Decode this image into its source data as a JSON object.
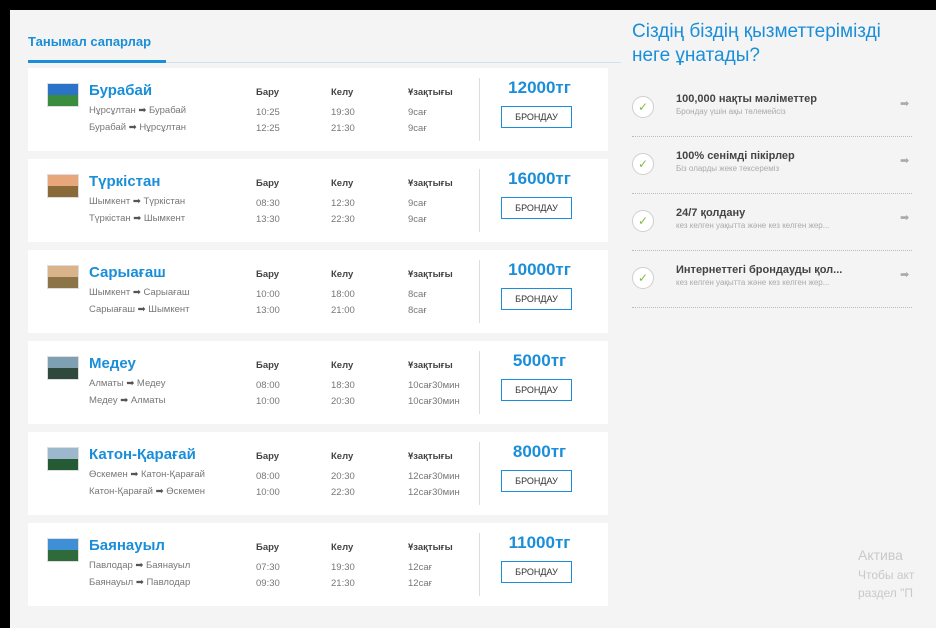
{
  "tab": {
    "label": "Танымал сапарлар"
  },
  "columns": {
    "depart": "Бару",
    "arrive": "Келу",
    "duration": "Ұзақтығы"
  },
  "book_label": "БРОНДАУ",
  "arrow": "➡",
  "trips": [
    {
      "city": "Бурабай",
      "route1_from": "Нұрсұлтан",
      "route1_to": "Бурабай",
      "route2_from": "Бурабай",
      "route2_to": "Нұрсұлтан",
      "dep1": "10:25",
      "arr1": "19:30",
      "dur1": "9сағ",
      "dep2": "12:25",
      "arr2": "21:30",
      "dur2": "9сағ",
      "price": "12000тг",
      "thumb_sky": "#2a73c9",
      "thumb_ground": "#3a8d3f"
    },
    {
      "city": "Түркістан",
      "route1_from": "Шымкент",
      "route1_to": "Түркістан",
      "route2_from": "Түркістан",
      "route2_to": "Шымкент",
      "dep1": "08:30",
      "arr1": "12:30",
      "dur1": "9сағ",
      "dep2": "13:30",
      "arr2": "22:30",
      "dur2": "9сағ",
      "price": "16000тг",
      "thumb_sky": "#e8a77a",
      "thumb_ground": "#8b6a3a"
    },
    {
      "city": "Сарыағаш",
      "route1_from": "Шымкент",
      "route1_to": "Сарыағаш",
      "route2_from": "Сарыағаш",
      "route2_to": "Шымкент",
      "dep1": "10:00",
      "arr1": "18:00",
      "dur1": "8сағ",
      "dep2": "13:00",
      "arr2": "21:00",
      "dur2": "8сағ",
      "price": "10000тг",
      "thumb_sky": "#d9b48a",
      "thumb_ground": "#8a7448"
    },
    {
      "city": "Медеу",
      "route1_from": "Алматы",
      "route1_to": "Медеу",
      "route2_from": "Медеу",
      "route2_to": "Алматы",
      "dep1": "08:00",
      "arr1": "18:30",
      "dur1": "10сағ30мин",
      "dep2": "10:00",
      "arr2": "20:30",
      "dur2": "10сағ30мин",
      "price": "5000тг",
      "thumb_sky": "#7f9fb3",
      "thumb_ground": "#2f4a3c"
    },
    {
      "city": "Катон-Қарағай",
      "route1_from": "Өскемен",
      "route1_to": "Катон-Қарағай",
      "route2_from": "Катон-Қарағай",
      "route2_to": "Өскемен",
      "dep1": "08:00",
      "arr1": "20:30",
      "dur1": "12сағ30мин",
      "dep2": "10:00",
      "arr2": "22:30",
      "dur2": "12сағ30мин",
      "price": "8000тг",
      "thumb_sky": "#9db8cc",
      "thumb_ground": "#245a34"
    },
    {
      "city": "Баянауыл",
      "route1_from": "Павлодар",
      "route1_to": "Баянауыл",
      "route2_from": "Баянауыл",
      "route2_to": "Павлодар",
      "dep1": "07:30",
      "arr1": "19:30",
      "dur1": "12сағ",
      "dep2": "09:30",
      "arr2": "21:30",
      "dur2": "12сағ",
      "price": "11000тг",
      "thumb_sky": "#3f8fd6",
      "thumb_ground": "#2f6b3a"
    }
  ],
  "why": {
    "heading": "Сіздің біздің қызметтерімізді неге ұнатады?",
    "features": [
      {
        "title": "100,000 нақты мәліметтер",
        "subtitle": "Брондау үшін ақы төлемейсіз"
      },
      {
        "title": "100% сенімді пікірлер",
        "subtitle": "Біз оларды жеке тексереміз"
      },
      {
        "title": "24/7 қолдану",
        "subtitle": "кез келген уақытта және кез келген жер..."
      },
      {
        "title": "Интернеттегі брондауды қол...",
        "subtitle": "кез келген уақытта және кез келген жер..."
      }
    ]
  },
  "watermark": {
    "line1": "Актива",
    "line2": "Чтобы акт",
    "line3": "раздел \"П"
  },
  "colors": {
    "accent": "#1a8ed8",
    "check": "#7dbb48"
  }
}
